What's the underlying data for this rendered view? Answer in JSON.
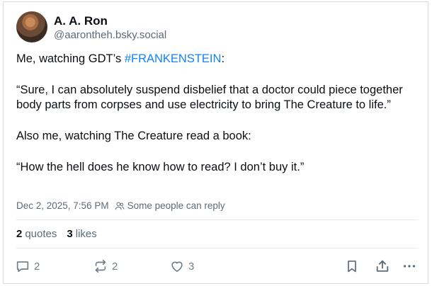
{
  "author": {
    "display_name": "A. A. Ron",
    "handle": "@aarontheh.bsky.social"
  },
  "post": {
    "line1_prefix": "Me, watching GDT’s ",
    "hashtag": "#FRANKENSTEIN",
    "line1_suffix": ":",
    "para2": "“Sure, I can absolutely suspend disbelief that a doctor could piece together body parts from corpses and use electricity to bring The Creature to life.”",
    "para3": "Also me, watching The Creature read a book:",
    "para4": "“How the hell does he know how to read? I don’t buy it.”"
  },
  "meta": {
    "timestamp": "Dec 2, 2025, 7:56 PM",
    "reply_setting": "Some people can reply"
  },
  "stats": {
    "quotes_count": "2",
    "quotes_label": "quotes",
    "likes_count": "3",
    "likes_label": "likes"
  },
  "actions": {
    "reply_count": "2",
    "repost_count": "2",
    "like_count": "3"
  },
  "icons": {
    "reply": "speech-bubble-icon",
    "repost": "repost-arrows-icon",
    "like": "heart-icon",
    "bookmark": "bookmark-icon",
    "share": "share-upload-icon",
    "more": "ellipsis-icon",
    "people": "people-icon"
  },
  "colors": {
    "hashtag": "#1083fe",
    "muted": "#5c6b7a",
    "text": "#0b0f14"
  }
}
